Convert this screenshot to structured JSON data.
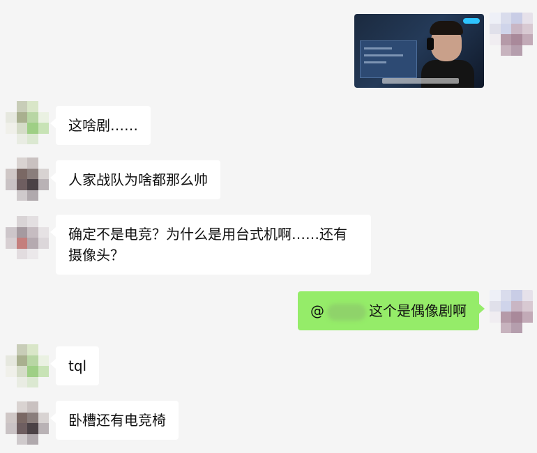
{
  "colors": {
    "background": "#f5f5f5",
    "incoming_bubble": "#ffffff",
    "outgoing_bubble": "#95ec69"
  },
  "messages": [
    {
      "side": "out",
      "type": "image"
    },
    {
      "side": "in",
      "text": "这啥剧……"
    },
    {
      "side": "in",
      "text": "人家战队为啥都那么帅"
    },
    {
      "side": "in",
      "text": "确定不是电竞？为什么是用台式机啊……还有摄像头？"
    },
    {
      "side": "out",
      "mention_prefix": "@",
      "text": "这个是偶像剧啊"
    },
    {
      "side": "in",
      "text": "tql"
    },
    {
      "side": "in",
      "text": "卧槽还有电竞椅"
    }
  ]
}
